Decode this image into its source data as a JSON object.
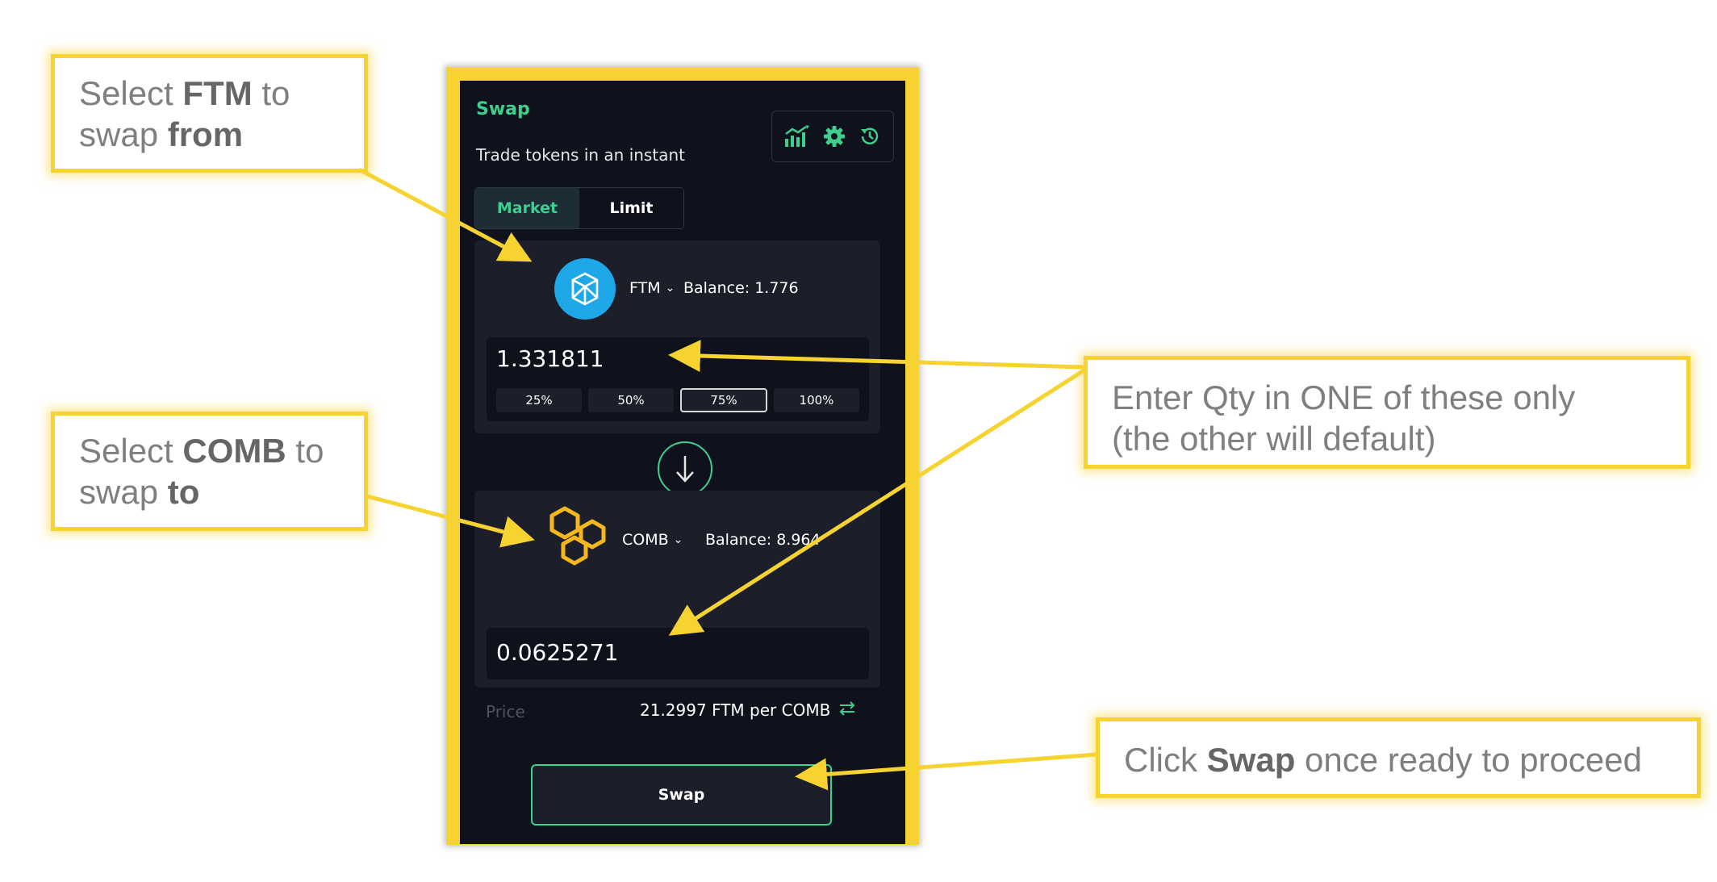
{
  "annotations": {
    "from": {
      "pre": "Select ",
      "bold": "FTM",
      "mid": " to",
      "line2": "swap ",
      "line2_bold": "from"
    },
    "to": {
      "pre": "Select ",
      "bold": "COMB",
      "mid": " to",
      "line2": "swap ",
      "line2_bold": "to"
    },
    "qty": {
      "line1": "Enter Qty in ONE of these only",
      "line2": "(the other will default)"
    },
    "swap": {
      "pre": "Click ",
      "bold": "Swap",
      "post": " once ready to proceed"
    }
  },
  "panel": {
    "title": "Swap",
    "subtitle": "Trade tokens in an instant",
    "toolbar_icons": [
      "chart-icon",
      "gear-icon",
      "history-icon"
    ],
    "tabs": [
      {
        "label": "Market",
        "active": true
      },
      {
        "label": "Limit",
        "active": false
      }
    ],
    "from": {
      "token": "FTM",
      "balance": "Balance: 1.776",
      "amount": "1.331811",
      "percents": [
        "25%",
        "50%",
        "75%",
        "100%"
      ],
      "selected_percent": "75%"
    },
    "to": {
      "token": "COMB",
      "balance": "Balance: 8.964",
      "amount": "0.0625271"
    },
    "price_label": "Price",
    "price_value": "21.2997 FTM per COMB",
    "swap_button": "Swap"
  },
  "colors": {
    "accent_green": "#3ecf8e",
    "highlight_yellow": "#f7d332",
    "panel_bg": "#0f121c",
    "card_bg": "#1c1f2a",
    "ftm_blue": "#1ea8e8",
    "comb_gold": "#f5b81c"
  }
}
